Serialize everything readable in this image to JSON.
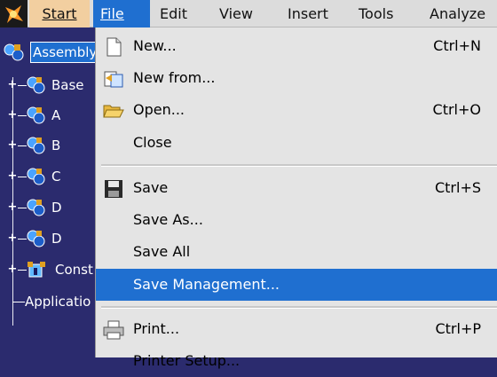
{
  "menubar": {
    "items": [
      {
        "label": "Start"
      },
      {
        "label": "File"
      },
      {
        "label": "Edit"
      },
      {
        "label": "View"
      },
      {
        "label": "Insert"
      },
      {
        "label": "Tools"
      },
      {
        "label": "Analyze"
      }
    ]
  },
  "tree": {
    "root": "Assembly",
    "children": [
      {
        "label": "Base"
      },
      {
        "label": "A"
      },
      {
        "label": "B"
      },
      {
        "label": "C"
      },
      {
        "label": "D"
      },
      {
        "label": "D"
      },
      {
        "label": "Const"
      },
      {
        "label": "Applicatio"
      }
    ]
  },
  "file_menu": {
    "items": [
      {
        "label": "New...",
        "shortcut": "Ctrl+N"
      },
      {
        "label": "New from...",
        "shortcut": ""
      },
      {
        "label": "Open...",
        "shortcut": "Ctrl+O"
      },
      {
        "label": "Close",
        "shortcut": ""
      },
      {
        "label": "Save",
        "shortcut": "Ctrl+S"
      },
      {
        "label": "Save As...",
        "shortcut": ""
      },
      {
        "label": "Save All",
        "shortcut": ""
      },
      {
        "label": "Save Management...",
        "shortcut": ""
      },
      {
        "label": "Print...",
        "shortcut": "Ctrl+P"
      },
      {
        "label": "Printer Setup...",
        "shortcut": ""
      }
    ],
    "highlighted": "Save Management..."
  },
  "colors": {
    "tree_bg": "#2b2b6e",
    "menubar_bg": "#dcdcdc",
    "start_bg": "#f2cfa0",
    "highlight": "#1f6fd0",
    "dropdown_bg": "#e4e4e4"
  }
}
